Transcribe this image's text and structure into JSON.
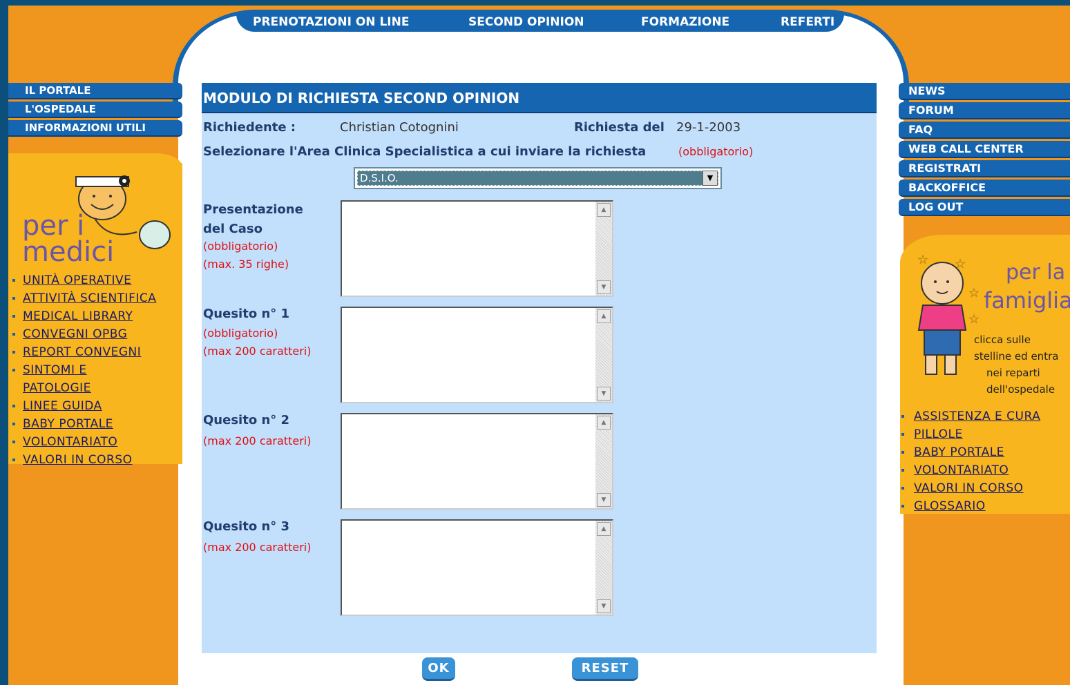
{
  "top_nav": [
    "PRENOTAZIONI ON LINE",
    "SECOND OPINION",
    "FORMAZIONE",
    "REFERTI"
  ],
  "left_menu": [
    "IL PORTALE",
    "L'OSPEDALE",
    "INFORMAZIONI UTILI"
  ],
  "left_section": {
    "logo_text_1": "per i",
    "logo_text_2": "medici",
    "links": [
      "UNITÀ OPERATIVE",
      "ATTIVITÀ SCIENTIFICA",
      "MEDICAL LIBRARY",
      "CONVEGNI OPBG",
      "REPORT CONVEGNI",
      "SINTOMI E PATOLOGIE",
      "LINEE GUIDA",
      "BABY PORTALE",
      "VOLONTARIATO",
      "VALORI IN CORSO"
    ]
  },
  "right_menu": [
    "NEWS",
    "FORUM",
    "FAQ",
    "WEB CALL CENTER",
    "REGISTRATI",
    "BACKOFFICE",
    "LOG OUT"
  ],
  "right_section": {
    "logo_text_1": "per la",
    "logo_text_2": "famiglia",
    "caption": [
      "clicca sulle",
      "stelline ed entra",
      "nei reparti",
      "dell'ospedale"
    ],
    "links": [
      "ASSISTENZA E CURA",
      "PILLOLE",
      "BABY PORTALE",
      "VOLONTARIATO",
      "VALORI IN CORSO",
      "GLOSSARIO"
    ]
  },
  "form": {
    "title": "MODULO DI RICHIESTA SECOND OPINION",
    "requester_label": "Richiedente :",
    "requester_value": "Christian Cotognini",
    "date_label": "Richiesta del",
    "date_value": "29-1-2003",
    "area_label": "Selezionare l'Area Clinica Specialistica a cui inviare la richiesta",
    "required_note": "(obbligatorio)",
    "area_selected": "D.S.I.O.",
    "case_label_1": "Presentazione",
    "case_label_2": "del Caso",
    "case_required": "(obbligatorio)",
    "case_limit": "(max. 35 righe)",
    "q1_label": "Quesito n° 1",
    "q1_required": "(obbligatorio)",
    "q1_limit": "(max 200 caratteri)",
    "q2_label": "Quesito n° 2",
    "q2_limit": "(max 200 caratteri)",
    "q3_label": "Quesito n° 3",
    "q3_limit": "(max 200 caratteri)",
    "ok_label": "OK",
    "reset_label": "RESET"
  },
  "colors": {
    "orange": "#f0961e",
    "yellow": "#f8b51d",
    "blue": "#1565b0",
    "panel": "#c2dffc",
    "required": "#e01010"
  }
}
